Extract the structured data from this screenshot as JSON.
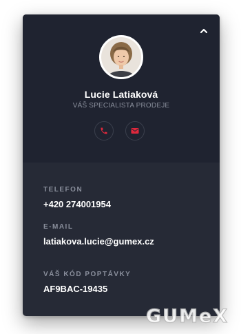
{
  "contact": {
    "name": "Lucie Latiaková",
    "role": "VÁŠ SPECIALISTA PRODEJE",
    "phone_label": "TELEFON",
    "phone_value": "+420 274001954",
    "email_label": "E-MAIL",
    "email_value": "latiakova.lucie@gumex.cz",
    "code_label": "VÁŠ KÓD POPTÁVKY",
    "code_value": "AF9BAC-19435"
  },
  "icons": {
    "collapse": "chevron-up-icon",
    "phone": "phone-icon",
    "mail": "mail-icon"
  },
  "watermark": "GUMeX",
  "colors": {
    "card_top": "#1f2330",
    "card_bottom": "#262a36",
    "accent": "#e0283c",
    "muted": "#8a8f9c"
  }
}
